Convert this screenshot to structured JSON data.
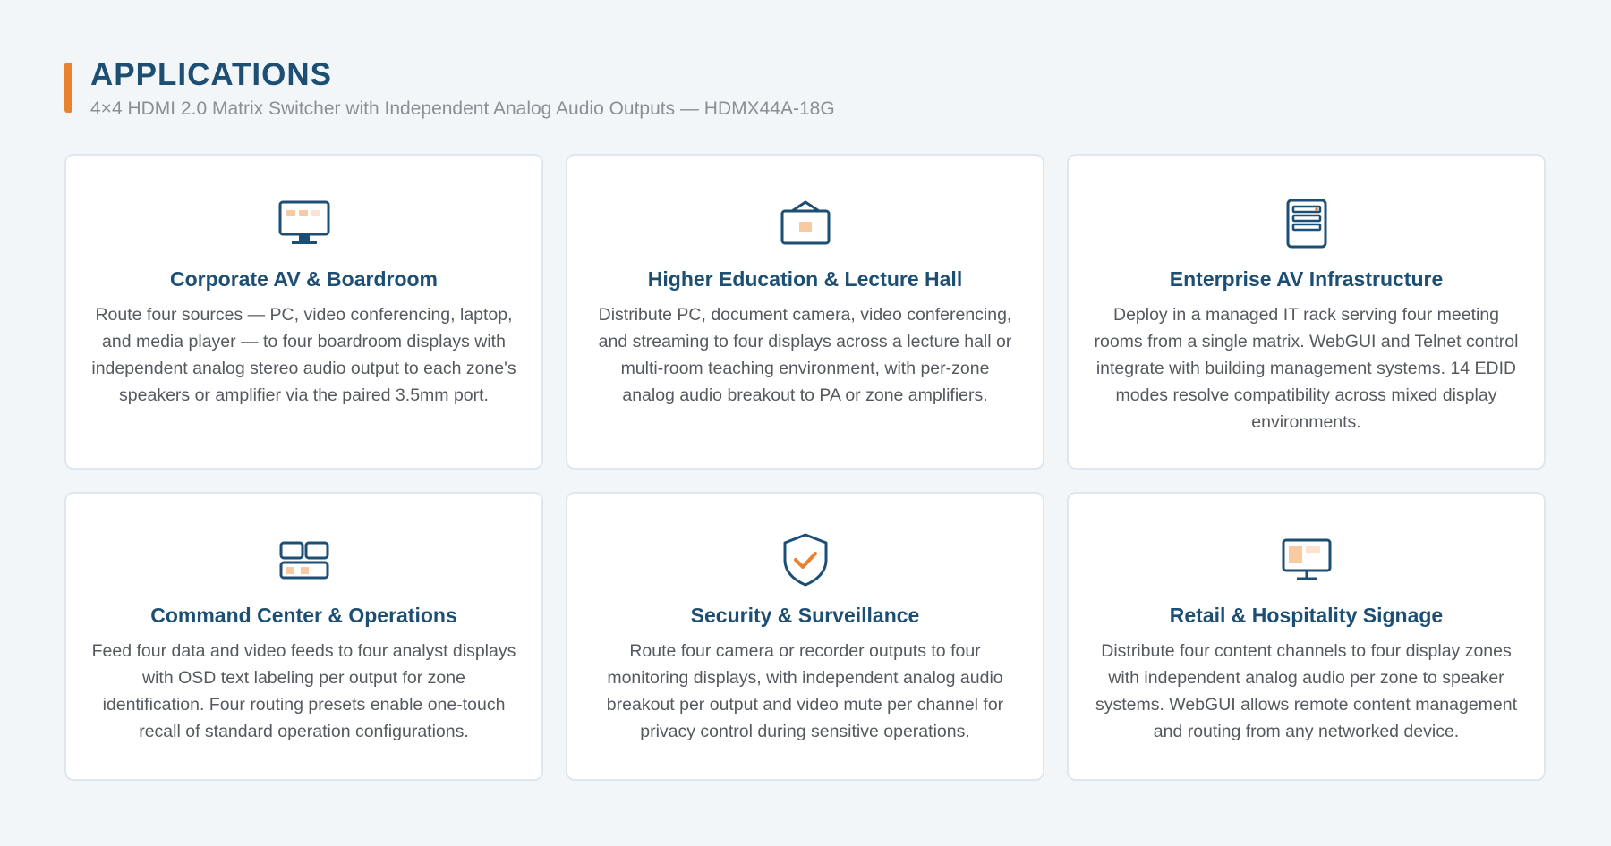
{
  "header": {
    "title": "APPLICATIONS",
    "subtitle": "4×4 HDMI 2.0 Matrix Switcher with Independent Analog Audio Outputs — HDMX44A-18G"
  },
  "colors": {
    "accent": "#e8822e",
    "primary": "#1d4e73",
    "icon_fill": "#f9c9a2",
    "background": "#f3f6f9"
  },
  "cards": [
    {
      "icon": "monitor-icon",
      "title": "Corporate AV & Boardroom",
      "description": "Route four sources — PC, video conferencing, laptop, and media player — to four boardroom displays with independent analog stereo audio output to each zone's speakers or amplifier via the paired 3.5mm port."
    },
    {
      "icon": "lecture-screen-icon",
      "title": "Higher Education & Lecture Hall",
      "description": "Distribute PC, document camera, video conferencing, and streaming to four displays across a lecture hall or multi-room teaching environment, with per-zone analog audio breakout to PA or zone amplifiers."
    },
    {
      "icon": "server-rack-icon",
      "title": "Enterprise AV Infrastructure",
      "description": "Deploy in a managed IT rack serving four meeting rooms from a single matrix. WebGUI and Telnet control integrate with building management systems. 14 EDID modes resolve compatibility across mixed display environments."
    },
    {
      "icon": "video-wall-icon",
      "title": "Command Center & Operations",
      "description": "Feed four data and video feeds to four analyst displays with OSD text labeling per output for zone identification. Four routing presets enable one-touch recall of standard operation configurations."
    },
    {
      "icon": "shield-check-icon",
      "title": "Security & Surveillance",
      "description": "Route four camera or recorder outputs to four monitoring displays, with independent analog audio breakout per output and video mute per channel for privacy control during sensitive operations."
    },
    {
      "icon": "signage-display-icon",
      "title": "Retail & Hospitality Signage",
      "description": "Distribute four content channels to four display zones with independent analog audio per zone to speaker systems. WebGUI allows remote content management and routing from any networked device."
    }
  ]
}
